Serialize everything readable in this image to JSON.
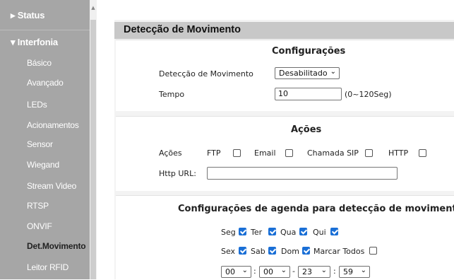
{
  "sidebar": {
    "status": "▸ Status",
    "interfonia": "▾ Interfonia",
    "items": [
      "Básico",
      "Avançado",
      "LEDs",
      "Acionamentos",
      "Sensor",
      "Wiegand",
      "Stream Video",
      "RTSP",
      "ONVIF",
      "Det.Movimento",
      "Leitor RFID"
    ],
    "active_item": "Det.Movimento",
    "scroll_arrow": "▲"
  },
  "page": {
    "title": "Detecção de Movimento"
  },
  "config": {
    "title": "Configurações",
    "motion_label": "Detecção de Movimento",
    "motion_value": "Desabilitado",
    "time_label": "Tempo",
    "time_value": "10",
    "time_range": "(0~120Seg)"
  },
  "actions": {
    "title": "Ações",
    "label": "Ações",
    "options": [
      {
        "label": "FTP",
        "checked": false
      },
      {
        "label": "Email",
        "checked": false
      },
      {
        "label": "Chamada SIP",
        "checked": false
      },
      {
        "label": "HTTP",
        "checked": false
      }
    ],
    "http_url_label": "Http URL:",
    "http_url_value": ""
  },
  "schedule": {
    "title": "Configurações de agenda para detecção de movimento",
    "days": [
      {
        "label": "Seg",
        "checked": true
      },
      {
        "label": "Ter",
        "checked": true
      },
      {
        "label": "Qua",
        "checked": true
      },
      {
        "label": "Qui",
        "checked": true
      },
      {
        "label": "Sex",
        "checked": true
      },
      {
        "label": "Sab",
        "checked": true
      },
      {
        "label": "Dom",
        "checked": true
      }
    ],
    "select_all_label": "Marcar Todos",
    "select_all_checked": false,
    "start_hour": "00",
    "start_min": "00",
    "end_hour": "23",
    "end_min": "59",
    "sep_colon": ":",
    "sep_dash": "-"
  },
  "icons": {
    "chevron": "chevron-down-icon"
  },
  "colors": {
    "sidebar_bg": "#a6a6a6",
    "title_bar": "#c8c8c8",
    "checkbox_on": "#1a6fd6"
  }
}
